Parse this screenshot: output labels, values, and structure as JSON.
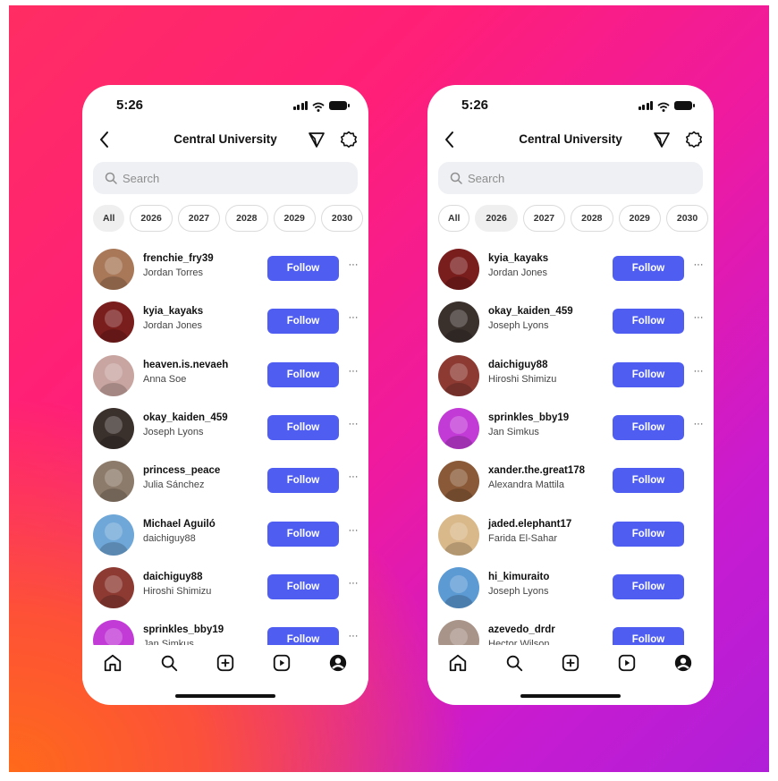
{
  "phones": [
    {
      "status_time": "5:26",
      "title": "Central University",
      "search_placeholder": "Search",
      "chips": [
        "All",
        "2026",
        "2027",
        "2028",
        "2029",
        "2030"
      ],
      "selected_chip": "All",
      "follow_label": "Follow",
      "more_label": "···",
      "rows": [
        {
          "username": "frenchie_fry39",
          "name": "Jordan Torres",
          "avatar_color": "#a87858",
          "has_more": true
        },
        {
          "username": "kyia_kayaks",
          "name": "Jordan Jones",
          "avatar_color": "#7a1d1d",
          "has_more": true
        },
        {
          "username": "heaven.is.nevaeh",
          "name": "Anna Soe",
          "avatar_color": "#c8a5a0",
          "has_more": true
        },
        {
          "username": "okay_kaiden_459",
          "name": "Joseph Lyons",
          "avatar_color": "#3a302c",
          "has_more": true
        },
        {
          "username": "princess_peace",
          "name": "Julia Sánchez",
          "avatar_color": "#8c7a6a",
          "has_more": true
        },
        {
          "username": "Michael Aguiló",
          "name": "daichiguy88",
          "avatar_color": "#6fa7d8",
          "has_more": true
        },
        {
          "username": "daichiguy88",
          "name": "Hiroshi Shimizu",
          "avatar_color": "#8d3a33",
          "has_more": true
        },
        {
          "username": "sprinkles_bby19",
          "name": "Jan Simkus",
          "avatar_color": "#c33bd6",
          "has_more": true
        }
      ]
    },
    {
      "status_time": "5:26",
      "title": "Central University",
      "search_placeholder": "Search",
      "chips": [
        "All",
        "2026",
        "2027",
        "2028",
        "2029",
        "2030"
      ],
      "selected_chip": "2026",
      "follow_label": "Follow",
      "more_label": "···",
      "rows": [
        {
          "username": "kyia_kayaks",
          "name": "Jordan Jones",
          "avatar_color": "#7a1d1d",
          "has_more": true
        },
        {
          "username": "okay_kaiden_459",
          "name": "Joseph Lyons",
          "avatar_color": "#3a302c",
          "has_more": true
        },
        {
          "username": "daichiguy88",
          "name": "Hiroshi Shimizu",
          "avatar_color": "#8d3a33",
          "has_more": true
        },
        {
          "username": "sprinkles_bby19",
          "name": "Jan Simkus",
          "avatar_color": "#c33bd6",
          "has_more": true
        },
        {
          "username": "xander.the.great178",
          "name": "Alexandra Mattila",
          "avatar_color": "#8a5a38",
          "has_more": false
        },
        {
          "username": "jaded.elephant17",
          "name": "Farida El-Sahar",
          "avatar_color": "#d9b98a",
          "has_more": false
        },
        {
          "username": "hi_kimuraito",
          "name": "Joseph Lyons",
          "avatar_color": "#5c9ad4",
          "has_more": false
        },
        {
          "username": "azevedo_drdr",
          "name": "Hector Wilson",
          "avatar_color": "#a89488",
          "has_more": false
        }
      ]
    }
  ],
  "colors": {
    "follow_button": "#4f5ef1",
    "gradient_start": "#ff2d63",
    "gradient_end": "#b01fd8",
    "gradient_glow": "#ff6a1a"
  },
  "icons": {
    "back": "chevron-left-icon",
    "filter": "paper-plane-icon",
    "settings": "gear-icon",
    "search": "search-icon",
    "tabs": [
      "home-icon",
      "explore-icon",
      "create-icon",
      "reels-icon",
      "profile-icon"
    ]
  }
}
